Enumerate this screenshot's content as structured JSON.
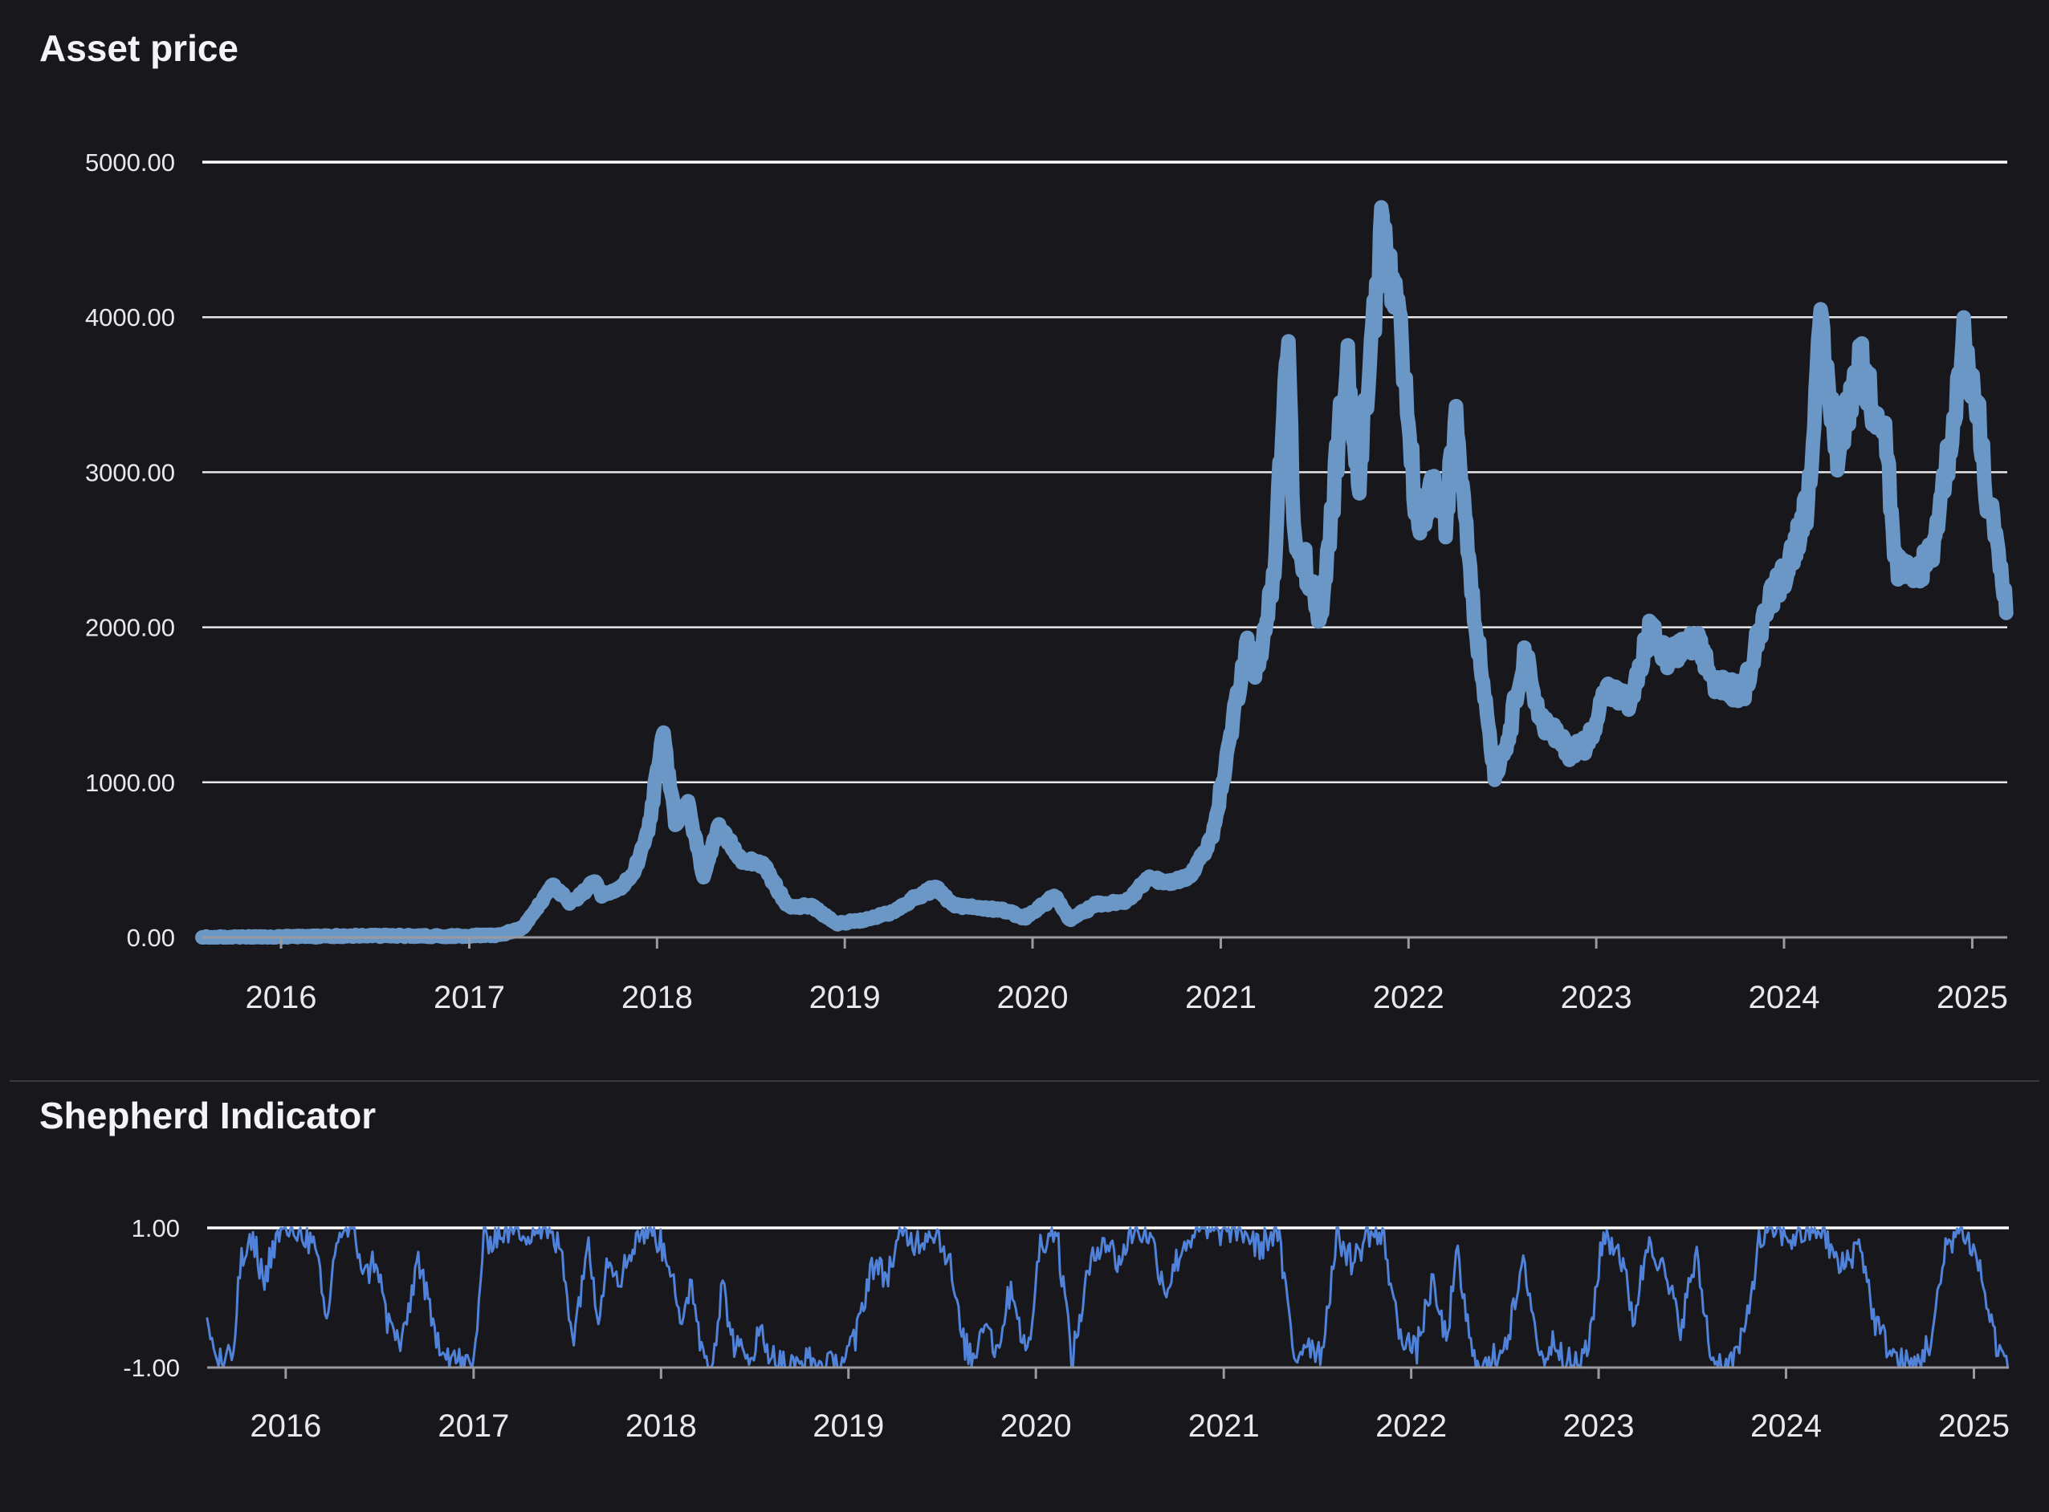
{
  "colors": {
    "background": "#18171c",
    "price_line": "#6a97c6",
    "indicator_line": "#4f82d8",
    "text": "#f4f4f6",
    "grid": "#e8e8ea"
  },
  "chart_data": [
    {
      "type": "line",
      "title": "Asset price",
      "xlabel": "",
      "ylabel": "",
      "x_axis": "date",
      "xlim": [
        "2015-08-01",
        "2025-03-10"
      ],
      "ylim": [
        0,
        5000
      ],
      "x_ticks": [
        "2016",
        "2017",
        "2018",
        "2019",
        "2020",
        "2021",
        "2022",
        "2023",
        "2024",
        "2025"
      ],
      "y_ticks": [
        "0.00",
        "1000.00",
        "2000.00",
        "3000.00",
        "4000.00",
        "5000.00"
      ],
      "y_tick_values": [
        0,
        1000,
        2000,
        3000,
        4000,
        5000
      ],
      "grid": true,
      "series": [
        {
          "color": "#6a97c6",
          "points": [
            [
              "2015-08-01",
              0
            ],
            [
              "2015-12-01",
              1
            ],
            [
              "2016-06-01",
              11
            ],
            [
              "2016-12-01",
              8
            ],
            [
              "2017-03-01",
              16
            ],
            [
              "2017-04-15",
              60
            ],
            [
              "2017-05-15",
              200
            ],
            [
              "2017-06-12",
              340
            ],
            [
              "2017-07-15",
              220
            ],
            [
              "2017-08-15",
              300
            ],
            [
              "2017-09-01",
              360
            ],
            [
              "2017-09-15",
              270
            ],
            [
              "2017-10-15",
              300
            ],
            [
              "2017-11-15",
              400
            ],
            [
              "2017-12-15",
              700
            ],
            [
              "2018-01-13",
              1300
            ],
            [
              "2018-02-06",
              720
            ],
            [
              "2018-03-01",
              870
            ],
            [
              "2018-04-01",
              400
            ],
            [
              "2018-05-01",
              700
            ],
            [
              "2018-06-15",
              500
            ],
            [
              "2018-07-24",
              480
            ],
            [
              "2018-09-12",
              200
            ],
            [
              "2018-11-01",
              200
            ],
            [
              "2018-12-15",
              90
            ],
            [
              "2019-02-01",
              105
            ],
            [
              "2019-04-01",
              160
            ],
            [
              "2019-05-15",
              250
            ],
            [
              "2019-06-26",
              320
            ],
            [
              "2019-08-01",
              210
            ],
            [
              "2019-09-15",
              190
            ],
            [
              "2019-11-01",
              180
            ],
            [
              "2019-12-17",
              125
            ],
            [
              "2020-02-14",
              270
            ],
            [
              "2020-03-13",
              110
            ],
            [
              "2020-05-01",
              210
            ],
            [
              "2020-07-01",
              230
            ],
            [
              "2020-08-15",
              390
            ],
            [
              "2020-09-15",
              350
            ],
            [
              "2020-11-01",
              390
            ],
            [
              "2020-12-15",
              640
            ],
            [
              "2021-01-15",
              1200
            ],
            [
              "2021-02-19",
              1900
            ],
            [
              "2021-03-15",
              1700
            ],
            [
              "2021-04-15",
              2400
            ],
            [
              "2021-05-12",
              3900
            ],
            [
              "2021-05-24",
              2500
            ],
            [
              "2021-06-15",
              2400
            ],
            [
              "2021-07-15",
              2000
            ],
            [
              "2021-08-15",
              3100
            ],
            [
              "2021-09-03",
              3800
            ],
            [
              "2021-09-25",
              2900
            ],
            [
              "2021-10-15",
              3600
            ],
            [
              "2021-11-10",
              4600
            ],
            [
              "2021-12-15",
              3900
            ],
            [
              "2022-01-20",
              2600
            ],
            [
              "2022-02-15",
              2900
            ],
            [
              "2022-03-15",
              2700
            ],
            [
              "2022-04-03",
              3400
            ],
            [
              "2022-05-12",
              2000
            ],
            [
              "2022-06-18",
              1050
            ],
            [
              "2022-07-15",
              1300
            ],
            [
              "2022-08-14",
              1850
            ],
            [
              "2022-09-15",
              1400
            ],
            [
              "2022-10-15",
              1300
            ],
            [
              "2022-11-10",
              1200
            ],
            [
              "2022-12-15",
              1250
            ],
            [
              "2023-01-20",
              1600
            ],
            [
              "2023-03-10",
              1500
            ],
            [
              "2023-04-15",
              2000
            ],
            [
              "2023-05-15",
              1800
            ],
            [
              "2023-06-15",
              1850
            ],
            [
              "2023-07-15",
              1900
            ],
            [
              "2023-08-18",
              1650
            ],
            [
              "2023-09-15",
              1600
            ],
            [
              "2023-10-15",
              1580
            ],
            [
              "2023-11-15",
              2000
            ],
            [
              "2023-12-15",
              2250
            ],
            [
              "2024-01-15",
              2450
            ],
            [
              "2024-02-15",
              2800
            ],
            [
              "2024-03-12",
              3900
            ],
            [
              "2024-04-15",
              3100
            ],
            [
              "2024-05-27",
              3750
            ],
            [
              "2024-06-15",
              3500
            ],
            [
              "2024-07-15",
              3300
            ],
            [
              "2024-08-05",
              2400
            ],
            [
              "2024-09-06",
              2300
            ],
            [
              "2024-10-15",
              2500
            ],
            [
              "2024-11-15",
              3100
            ],
            [
              "2024-12-16",
              3850
            ],
            [
              "2025-01-15",
              3300
            ],
            [
              "2025-02-03",
              2700
            ],
            [
              "2025-02-15",
              2700
            ],
            [
              "2025-03-01",
              2250
            ],
            [
              "2025-03-08",
              2150
            ]
          ]
        }
      ]
    },
    {
      "type": "line",
      "title": "Shepherd Indicator",
      "xlabel": "",
      "ylabel": "",
      "x_axis": "date",
      "xlim": [
        "2015-08-01",
        "2025-03-10"
      ],
      "ylim": [
        -1,
        1
      ],
      "x_ticks": [
        "2016",
        "2017",
        "2018",
        "2019",
        "2020",
        "2021",
        "2022",
        "2023",
        "2024",
        "2025"
      ],
      "y_ticks": [
        "-1.00",
        "1.00"
      ],
      "y_tick_values": [
        -1,
        1
      ],
      "grid": true,
      "series": [
        {
          "color": "#4f82d8",
          "points": [
            [
              "2015-08-01",
              -0.3
            ],
            [
              "2015-08-15",
              -0.8
            ],
            [
              "2015-09-01",
              -0.95
            ],
            [
              "2015-09-20",
              -0.85
            ],
            [
              "2015-10-05",
              0.5
            ],
            [
              "2015-11-01",
              0.8
            ],
            [
              "2015-11-20",
              0.2
            ],
            [
              "2015-12-05",
              0.7
            ],
            [
              "2015-12-20",
              0.9
            ],
            [
              "2016-01-10",
              1.0
            ],
            [
              "2016-02-05",
              0.95
            ],
            [
              "2016-03-01",
              0.6
            ],
            [
              "2016-03-20",
              -0.4
            ],
            [
              "2016-04-10",
              0.9
            ],
            [
              "2016-05-10",
              1.0
            ],
            [
              "2016-06-05",
              0.3
            ],
            [
              "2016-06-25",
              0.6
            ],
            [
              "2016-07-15",
              -0.3
            ],
            [
              "2016-08-15",
              -0.7
            ],
            [
              "2016-09-15",
              0.6
            ],
            [
              "2016-10-15",
              -0.5
            ],
            [
              "2016-11-15",
              -0.8
            ],
            [
              "2016-12-10",
              -0.95
            ],
            [
              "2017-01-01",
              -1.0
            ],
            [
              "2017-01-20",
              0.8
            ],
            [
              "2017-02-15",
              0.9
            ],
            [
              "2017-03-15",
              1.0
            ],
            [
              "2017-04-15",
              0.95
            ],
            [
              "2017-05-15",
              1.0
            ],
            [
              "2017-06-20",
              0.7
            ],
            [
              "2017-07-15",
              -0.6
            ],
            [
              "2017-08-10",
              0.8
            ],
            [
              "2017-09-01",
              -0.2
            ],
            [
              "2017-09-20",
              0.6
            ],
            [
              "2017-10-15",
              0.3
            ],
            [
              "2017-11-15",
              0.9
            ],
            [
              "2017-12-15",
              1.0
            ],
            [
              "2018-01-25",
              0.4
            ],
            [
              "2018-02-10",
              -0.6
            ],
            [
              "2018-03-01",
              0.3
            ],
            [
              "2018-03-20",
              -0.7
            ],
            [
              "2018-04-10",
              -0.95
            ],
            [
              "2018-05-01",
              0.2
            ],
            [
              "2018-05-20",
              -0.6
            ],
            [
              "2018-06-15",
              -0.9
            ],
            [
              "2018-07-15",
              -0.5
            ],
            [
              "2018-08-10",
              -0.9
            ],
            [
              "2018-09-15",
              -1.0
            ],
            [
              "2018-10-15",
              -0.9
            ],
            [
              "2018-11-15",
              -1.0
            ],
            [
              "2018-12-15",
              -0.95
            ],
            [
              "2019-01-15",
              -0.6
            ],
            [
              "2019-02-15",
              0.5
            ],
            [
              "2019-03-15",
              0.3
            ],
            [
              "2019-04-15",
              0.9
            ],
            [
              "2019-05-15",
              0.8
            ],
            [
              "2019-06-15",
              1.0
            ],
            [
              "2019-07-15",
              0.6
            ],
            [
              "2019-08-10",
              -0.6
            ],
            [
              "2019-09-01",
              -0.9
            ],
            [
              "2019-09-25",
              -0.2
            ],
            [
              "2019-10-15",
              -0.8
            ],
            [
              "2019-11-15",
              0.2
            ],
            [
              "2019-12-15",
              -0.9
            ],
            [
              "2020-01-10",
              0.8
            ],
            [
              "2020-02-10",
              1.0
            ],
            [
              "2020-03-12",
              -0.9
            ],
            [
              "2020-04-10",
              0.3
            ],
            [
              "2020-05-10",
              0.9
            ],
            [
              "2020-06-10",
              0.5
            ],
            [
              "2020-07-10",
              1.0
            ],
            [
              "2020-08-10",
              0.9
            ],
            [
              "2020-09-10",
              0.1
            ],
            [
              "2020-10-10",
              0.7
            ],
            [
              "2020-11-10",
              1.0
            ],
            [
              "2020-12-10",
              0.9
            ],
            [
              "2021-01-10",
              1.0
            ],
            [
              "2021-02-10",
              0.95
            ],
            [
              "2021-03-10",
              0.7
            ],
            [
              "2021-04-15",
              1.0
            ],
            [
              "2021-05-19",
              -0.9
            ],
            [
              "2021-06-10",
              -0.6
            ],
            [
              "2021-07-10",
              -0.8
            ],
            [
              "2021-08-10",
              0.9
            ],
            [
              "2021-09-10",
              0.5
            ],
            [
              "2021-10-10",
              0.95
            ],
            [
              "2021-11-10",
              0.8
            ],
            [
              "2021-12-05",
              -0.4
            ],
            [
              "2022-01-10",
              -0.8
            ],
            [
              "2022-02-10",
              0.2
            ],
            [
              "2022-03-10",
              -0.6
            ],
            [
              "2022-04-01",
              0.6
            ],
            [
              "2022-05-01",
              -0.9
            ],
            [
              "2022-06-01",
              -1.0
            ],
            [
              "2022-07-10",
              -0.5
            ],
            [
              "2022-08-10",
              0.5
            ],
            [
              "2022-09-10",
              -0.9
            ],
            [
              "2022-10-10",
              -0.6
            ],
            [
              "2022-11-10",
              -1.0
            ],
            [
              "2022-12-10",
              -0.8
            ],
            [
              "2023-01-10",
              0.9
            ],
            [
              "2023-02-10",
              0.7
            ],
            [
              "2023-03-10",
              -0.3
            ],
            [
              "2023-04-10",
              0.9
            ],
            [
              "2023-05-10",
              0.3
            ],
            [
              "2023-06-10",
              -0.4
            ],
            [
              "2023-07-10",
              0.6
            ],
            [
              "2023-08-10",
              -0.9
            ],
            [
              "2023-09-10",
              -1.0
            ],
            [
              "2023-10-10",
              -0.6
            ],
            [
              "2023-11-10",
              0.8
            ],
            [
              "2023-12-10",
              1.0
            ],
            [
              "2024-01-10",
              0.85
            ],
            [
              "2024-02-10",
              0.95
            ],
            [
              "2024-03-10",
              1.0
            ],
            [
              "2024-04-15",
              0.4
            ],
            [
              "2024-05-25",
              0.8
            ],
            [
              "2024-06-20",
              -0.3
            ],
            [
              "2024-07-10",
              -0.6
            ],
            [
              "2024-08-05",
              -0.9
            ],
            [
              "2024-09-05",
              -1.0
            ],
            [
              "2024-10-10",
              -0.6
            ],
            [
              "2024-11-10",
              0.8
            ],
            [
              "2024-12-10",
              1.0
            ],
            [
              "2025-01-10",
              0.5
            ],
            [
              "2025-02-01",
              -0.3
            ],
            [
              "2025-02-20",
              -0.8
            ],
            [
              "2025-03-08",
              -0.9
            ]
          ]
        }
      ]
    }
  ]
}
